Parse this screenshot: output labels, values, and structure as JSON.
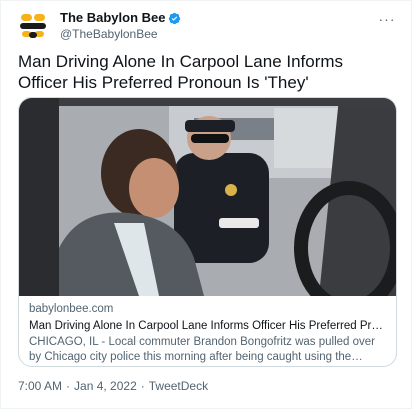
{
  "author": {
    "display_name": "The Babylon Bee",
    "handle": "@TheBabylonBee",
    "verified": true,
    "avatar_icon": "bee-logo-icon"
  },
  "menu": {
    "more_icon": "more-horizontal-icon",
    "more_label": "···"
  },
  "tweet": {
    "text": "Man Driving Alone In Carpool Lane Informs Officer His Preferred Pronoun Is 'They'"
  },
  "card": {
    "domain": "babylonbee.com",
    "title": "Man Driving Alone In Carpool Lane Informs Officer His Preferred Pronoun Is 'T...",
    "description": "CHICAGO, IL - Local commuter Brandon Bongofritz was pulled over by Chicago city police this morning after being caught using the carpool lane even though ..."
  },
  "meta": {
    "time": "7:00 AM",
    "separator": "·",
    "date": "Jan 4, 2022",
    "source": "TweetDeck"
  },
  "colors": {
    "text_primary": "#0f1419",
    "text_secondary": "#536471",
    "verified_blue": "#1d9bf0",
    "border": "#cfd9de"
  }
}
